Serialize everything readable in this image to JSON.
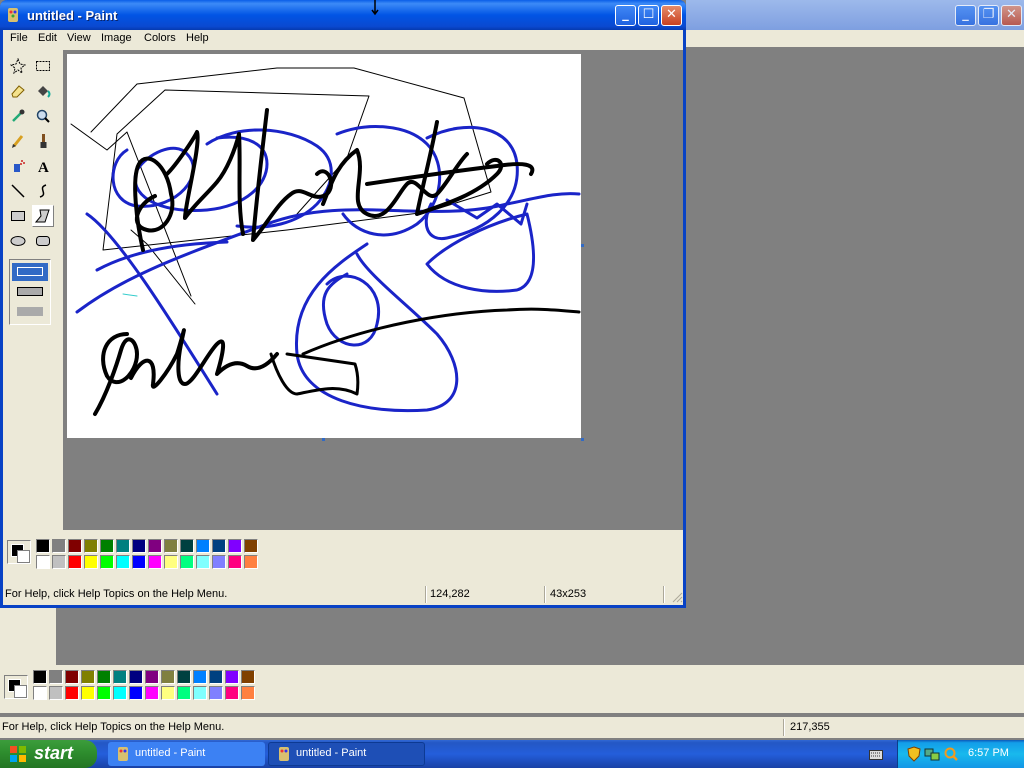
{
  "background_window": {
    "palette_colors_top": [
      "#000000",
      "#808080",
      "#800000",
      "#808000",
      "#008000",
      "#008080",
      "#000080",
      "#800080",
      "#808040",
      "#004040",
      "#0080ff",
      "#004080",
      "#8000ff",
      "#804000"
    ],
    "palette_colors_bottom": [
      "#ffffff",
      "#c0c0c0",
      "#ff0000",
      "#ffff00",
      "#00ff00",
      "#00ffff",
      "#0000ff",
      "#ff00ff",
      "#ffff80",
      "#00ff80",
      "#80ffff",
      "#8080ff",
      "#ff0080",
      "#ff8040"
    ],
    "status_help": "For Help, click Help Topics on the Help Menu.",
    "status_coords": "217,355"
  },
  "window": {
    "title": "untitled - Paint",
    "menu": [
      "File",
      "Edit",
      "View",
      "Image",
      "Colors",
      "Help"
    ],
    "tools": [
      "free-form-select",
      "select",
      "eraser",
      "fill-with-color",
      "pick-color",
      "magnifier",
      "pencil",
      "brush",
      "airbrush",
      "text",
      "line",
      "curve",
      "rectangle",
      "polygon",
      "ellipse",
      "rounded-rectangle"
    ],
    "selected_tool": "polygon",
    "palette_colors_top": [
      "#000000",
      "#808080",
      "#800000",
      "#808000",
      "#008000",
      "#008080",
      "#000080",
      "#800080",
      "#808040",
      "#004040",
      "#0080ff",
      "#004080",
      "#8000ff",
      "#804000"
    ],
    "palette_colors_bottom": [
      "#ffffff",
      "#c0c0c0",
      "#ff0000",
      "#ffff00",
      "#00ff00",
      "#00ffff",
      "#0000ff",
      "#ff00ff",
      "#ffff80",
      "#00ff80",
      "#80ffff",
      "#8080ff",
      "#ff0080",
      "#ff8040"
    ],
    "foreground_color": "#000000",
    "background_color": "#ffffff",
    "status_help": "For Help, click Help Topics on the Help Menu.",
    "status_coords": "124,282",
    "status_size": "43x253"
  },
  "taskbar": {
    "start_label": "start",
    "tasks": [
      "untitled - Paint",
      "untitled - Paint"
    ],
    "clock": "6:57 PM"
  },
  "colors": {
    "stroke_blue": "#1a24c8",
    "stroke_black": "#000000",
    "stroke_cyan": "#33cccc"
  }
}
